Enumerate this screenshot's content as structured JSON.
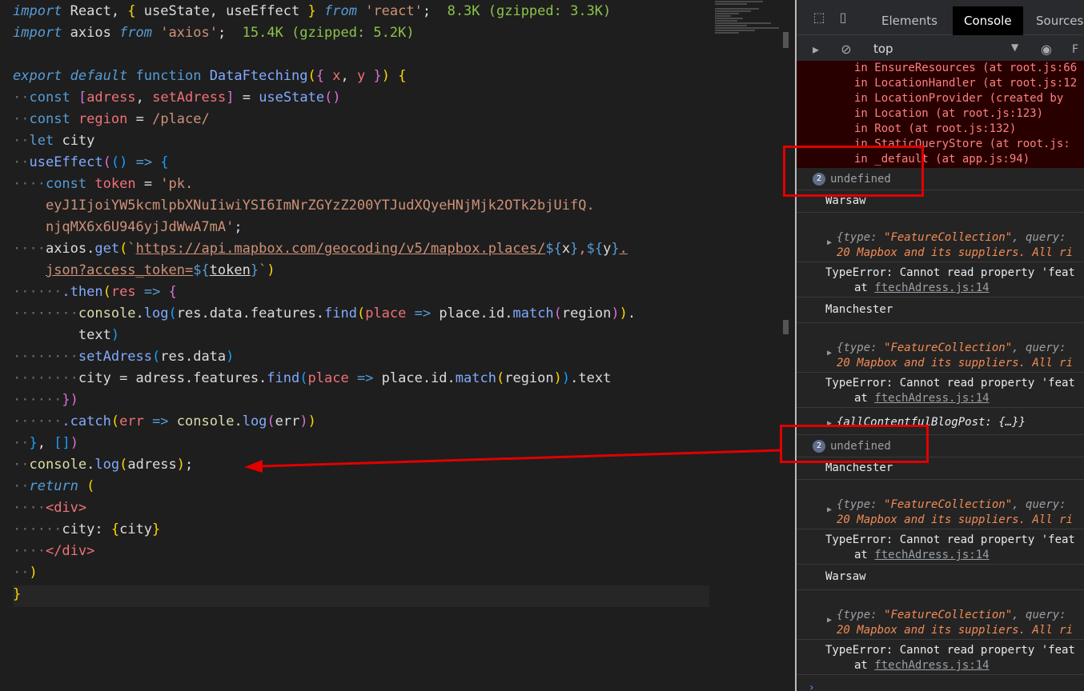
{
  "editor": {
    "import1": "import React, { useState, useEffect } from 'react';",
    "import1_size": "8.3K (gzipped: 3.3K)",
    "import2": "import axios from 'axios';",
    "import2_size": "15.4K (gzipped: 5.2K)",
    "lines": [
      "export default function DataFteching({ x, y }) {",
      "  const [adress, setAdress] = useState()",
      "  const region = /place/",
      "  let city",
      "  useEffect(() => {",
      "    const token = 'pk.",
      "    eyJ1IjoiYW5kcmlpbXNuIiwiYSI6ImNrZGYzZ200YTJudXQyeHNjMjk2OTk2bjUifQ.",
      "    njqMX6x6U946yjJdWwA7mA';",
      "    axios.get(`https://api.mapbox.com/geocoding/v5/mapbox.places/${x},${y}.",
      "    json?access_token=${token}`)",
      "      .then(res => {",
      "        console.log(res.data.features.find(place => place.id.match(region)).",
      "        text)",
      "        setAdress(res.data)",
      "        city = adress.features.find(place => place.id.match(region)).text",
      "      })",
      "      .catch(err => console.log(err))",
      "  }, [])",
      "  console.log(adress);",
      "  return (",
      "    <div>",
      "      city: {city}",
      "    </div>",
      "  )",
      "}"
    ]
  },
  "devtools": {
    "tabs": [
      "Elements",
      "Console",
      "Sources"
    ],
    "active_tab": "Console",
    "context": "top",
    "filter": "F",
    "errors": [
      "in EnsureResources (at root.js:66",
      "in LocationHandler (at root.js:12",
      "in LocationProvider (created by",
      "in Location (at root.js:123)",
      "in Root (at root.js:132)",
      "in StaticQueryStore (at root.js:",
      "in _default (at app.js:94)"
    ],
    "undefined_badge": "2",
    "undefined_text": "undefined",
    "city_warsaw": "Warsaw",
    "city_manchester": "Manchester",
    "obj_prefix": "{",
    "obj_key": "type: ",
    "obj_value": "\"FeatureCollection\"",
    "obj_suffix": ", query:",
    "obj_line2": "20 Mapbox and its suppliers. All ri",
    "type_error": "TypeError: Cannot read property 'feat",
    "error_at": "at ",
    "error_link": "ftechAdress.js:14",
    "blog_post": "{allContentfulBlogPost: {…}}"
  }
}
